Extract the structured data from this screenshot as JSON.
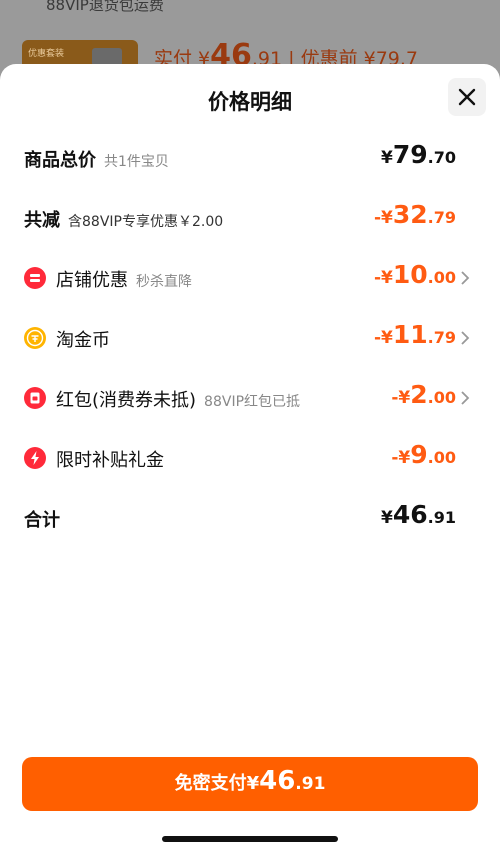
{
  "background": {
    "note": "88VIP退货包运费",
    "thumb_tag": "优惠套装",
    "price_text": "实付 ¥",
    "price_int": "46",
    "price_dec": ".91",
    "before_text": " | 优惠前 ¥79.7"
  },
  "sheet": {
    "title": "价格明细",
    "rows": [
      {
        "label": "商品总价",
        "sub": "共1件宝贝",
        "sym": "¥",
        "int": "79",
        "dec": ".70",
        "color": "#111111",
        "icon": "",
        "arrow": false
      },
      {
        "label": "共减",
        "sub": "含88VIP专享优惠￥2.00",
        "sym": "-¥",
        "int": "32",
        "dec": ".79",
        "color": "#ff5b12",
        "icon": "",
        "arrow": false
      },
      {
        "label": "店铺优惠",
        "sub": "秒杀直降",
        "sym": "-¥",
        "int": "10",
        "dec": ".00",
        "color": "#ff5b12",
        "icon": "store-discount-icon",
        "arrow": true
      },
      {
        "label": "淘金币",
        "sub": "",
        "sym": "-¥",
        "int": "11",
        "dec": ".79",
        "color": "#ff5b12",
        "icon": "gold-coin-icon",
        "arrow": true
      },
      {
        "label": "红包(消费券未抵)",
        "sub": "88VIP红包已抵",
        "sym": "-¥",
        "int": "2",
        "dec": ".00",
        "color": "#ff5b12",
        "icon": "red-packet-icon",
        "arrow": true
      },
      {
        "label": "限时补贴礼金",
        "sub": "",
        "sym": "-¥",
        "int": "9",
        "dec": ".00",
        "color": "#ff5b12",
        "icon": "lightning-subsidy-icon",
        "arrow": true
      }
    ],
    "total": {
      "label": "合计",
      "sym": "¥",
      "int": "46",
      "dec": ".91"
    }
  },
  "pay_button": {
    "label": "免密支付",
    "sym": "¥",
    "int": "46",
    "dec": ".91",
    "color": "#ff5f00"
  },
  "colors": {
    "accent": "#ff5b12",
    "text": "#111111",
    "muted": "#888888"
  }
}
